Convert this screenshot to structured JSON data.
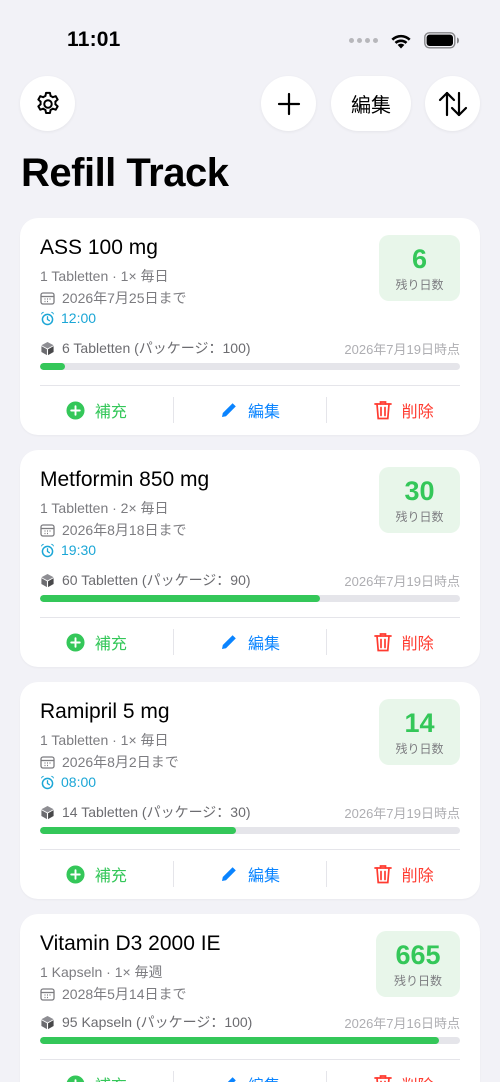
{
  "status_bar": {
    "time": "11:01"
  },
  "toolbar": {
    "edit_label": "編集"
  },
  "header": {
    "title": "Refill Track"
  },
  "actions": {
    "refill": "補充",
    "edit": "編集",
    "delete": "削除"
  },
  "colors": {
    "accent_green": "#34c759",
    "accent_blue": "#0a84ff",
    "accent_red": "#ff3b30",
    "alarm_cyan": "#1ba6d6"
  },
  "medications": [
    {
      "name": "ASS 100 mg",
      "dose": "1 Tabletten · 1× 毎日",
      "until": "2026年7月25日まで",
      "alarm": "12:00",
      "days_left": "6",
      "days_label": "残り日数",
      "stock": "6 Tabletten (パッケージ：100)",
      "stock_date": "2026年7月19日時点",
      "stock_fraction": 0.06
    },
    {
      "name": "Metformin 850 mg",
      "dose": "1 Tabletten · 2× 毎日",
      "until": "2026年8月18日まで",
      "alarm": "19:30",
      "days_left": "30",
      "days_label": "残り日数",
      "stock": "60 Tabletten (パッケージ：90)",
      "stock_date": "2026年7月19日時点",
      "stock_fraction": 0.667
    },
    {
      "name": "Ramipril 5 mg",
      "dose": "1 Tabletten · 1× 毎日",
      "until": "2026年8月2日まで",
      "alarm": "08:00",
      "days_left": "14",
      "days_label": "残り日数",
      "stock": "14 Tabletten (パッケージ：30)",
      "stock_date": "2026年7月19日時点",
      "stock_fraction": 0.467
    },
    {
      "name": "Vitamin D3 2000 IE",
      "dose": "1 Kapseln · 1× 毎週",
      "until": "2028年5月14日まで",
      "alarm": "",
      "days_left": "665",
      "days_label": "残り日数",
      "stock": "95 Kapseln (パッケージ：100)",
      "stock_date": "2026年7月16日時点",
      "stock_fraction": 0.95
    }
  ]
}
